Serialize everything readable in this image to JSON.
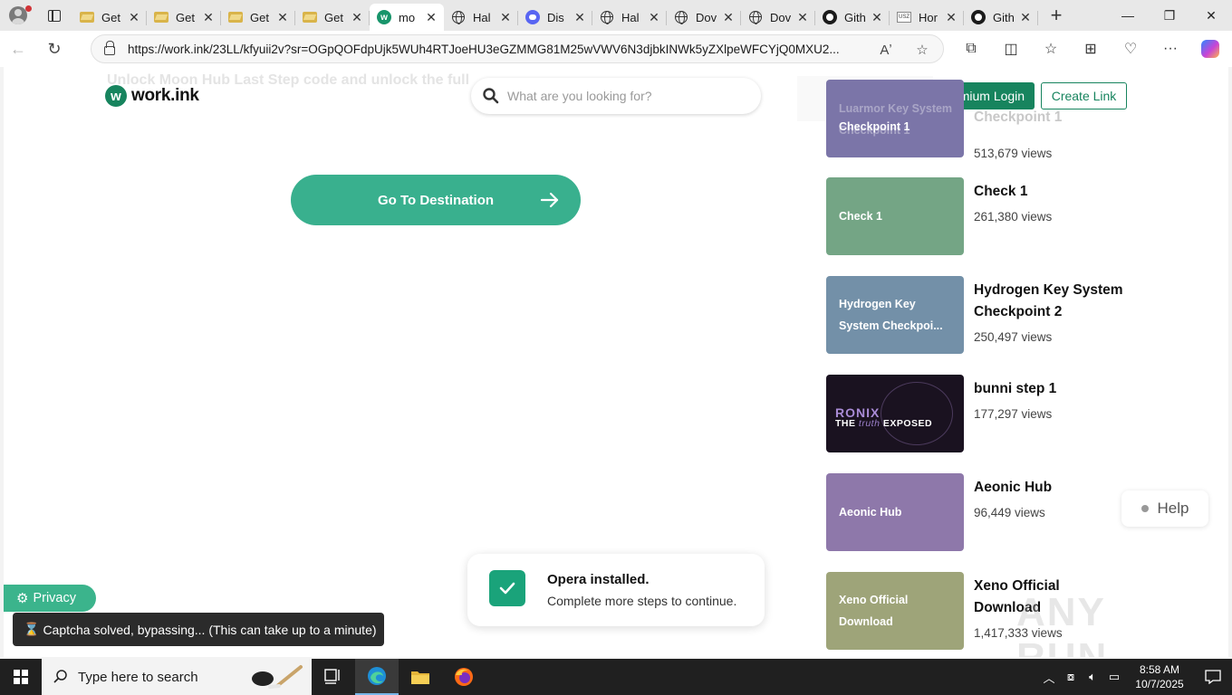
{
  "browser": {
    "tabs": [
      {
        "title": "Get",
        "icon": "folder-favicon"
      },
      {
        "title": "Get",
        "icon": "folder-favicon"
      },
      {
        "title": "Get",
        "icon": "folder-favicon"
      },
      {
        "title": "Get",
        "icon": "folder-favicon"
      },
      {
        "title": "mo",
        "icon": "workink-favicon",
        "active": true
      },
      {
        "title": "Hal",
        "icon": "globe-favicon"
      },
      {
        "title": "Dis",
        "icon": "discord-favicon"
      },
      {
        "title": "Hal",
        "icon": "globe-favicon"
      },
      {
        "title": "Dov",
        "icon": "globe-favicon"
      },
      {
        "title": "Dov",
        "icon": "globe-favicon"
      },
      {
        "title": "Gith",
        "icon": "github-favicon"
      },
      {
        "title": "Hor",
        "icon": "usz-favicon"
      },
      {
        "title": "Gith",
        "icon": "github-favicon"
      }
    ],
    "url": "https://work.ink/23LL/kfyuii2v?sr=OGpQOFdpUjk5WUh4RTJoeHU3eGZMMG81M25wVWV6N3djbkINWk5yZXlpeWFCYjQ0MXU2..."
  },
  "site": {
    "logo_mark": "w",
    "logo_text": "work.ink",
    "ghost_title": "Unlock Moon Hub Last Step code and unlock the full",
    "search_placeholder": "What are you looking for?",
    "premium_login": "Premium Login",
    "create_link": "Create Link",
    "go_to_destination": "Go To Destination",
    "help": "Help",
    "privacy": "Privacy",
    "captcha_status": "Captcha solved, bypassing... (This can take up to a minute)",
    "toast": {
      "title": "Opera installed.",
      "subtitle": "Complete more steps to continue."
    },
    "watermark": "ANY RUN"
  },
  "sidebar": {
    "cards": [
      {
        "thumb": "Luarmor Key System Checkpoint 1",
        "title": "Checkpoint 1",
        "views": "513,679 views",
        "color": "#7b75a8"
      },
      {
        "thumb": "Check 1",
        "title": "Check 1",
        "views": "261,380 views",
        "color": "#74a585"
      },
      {
        "thumb": "Hydrogen Key System Checkpoi...",
        "title": "Hydrogen Key System Checkpoint 2",
        "views": "250,497 views",
        "color": "#7390a8"
      },
      {
        "thumb_line1": "RONIX",
        "thumb_line2a": "THE",
        "thumb_line2b": "truth",
        "thumb_line2c": "EXPOSED",
        "title": "bunni step 1",
        "views": "177,297 views",
        "color": "#1a1220"
      },
      {
        "thumb": "Aeonic Hub",
        "title": "Aeonic Hub",
        "views": "96,449 views",
        "color": "#8e78aa"
      },
      {
        "thumb": "Xeno Official Download",
        "title": "Xeno Official Download",
        "views": "1,417,333 views",
        "color": "#9ea479"
      }
    ]
  },
  "taskbar": {
    "search_text": "Type here to search",
    "time": "8:58 AM",
    "date": "10/7/2025"
  }
}
